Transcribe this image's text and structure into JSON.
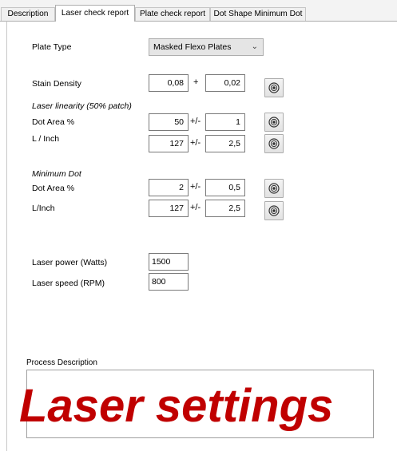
{
  "tabs": [
    {
      "label": "Description",
      "active": false
    },
    {
      "label": "Laser check report",
      "active": true
    },
    {
      "label": "Plate check report",
      "active": false
    },
    {
      "label": "Dot Shape Minimum Dot",
      "active": false
    }
  ],
  "form": {
    "plate_type_label": "Plate Type",
    "plate_type_value": "Masked Flexo Plates",
    "stain_density_label": "Stain Density",
    "stain_density_value": "0,08",
    "stain_density_plus": "+",
    "stain_density_tolerance": "0,02",
    "laser_linearity_heading": "Laser linearity (50% patch)",
    "linearity_dot_area_label": "Dot Area %",
    "linearity_dot_area_value": "50",
    "linearity_dot_area_pm": "+/-",
    "linearity_dot_area_tolerance": "1",
    "linearity_lpi_label": "L / Inch",
    "linearity_lpi_value": "127",
    "linearity_lpi_pm": "+/-",
    "linearity_lpi_tolerance": "2,5",
    "minimum_dot_heading": "Minimum Dot",
    "mindot_dot_area_label": "Dot Area %",
    "mindot_dot_area_value": "2",
    "mindot_dot_area_pm": "+/-",
    "mindot_dot_area_tolerance": "0,5",
    "mindot_lpi_label": "L/Inch",
    "mindot_lpi_value": "127",
    "mindot_lpi_pm": "+/-",
    "mindot_lpi_tolerance": "2,5",
    "laser_power_label": "Laser power (Watts)",
    "laser_power_value": "1500",
    "laser_speed_label": "Laser speed (RPM)",
    "laser_speed_value": "800",
    "process_description_label": "Process Description"
  },
  "overlay_caption": "Laser settings",
  "icons": {
    "target_button": "target-icon",
    "dropdown": "chevron-down-icon"
  },
  "colors": {
    "overlay_text": "#c00000",
    "tab_bar": "#f3f3f3"
  }
}
